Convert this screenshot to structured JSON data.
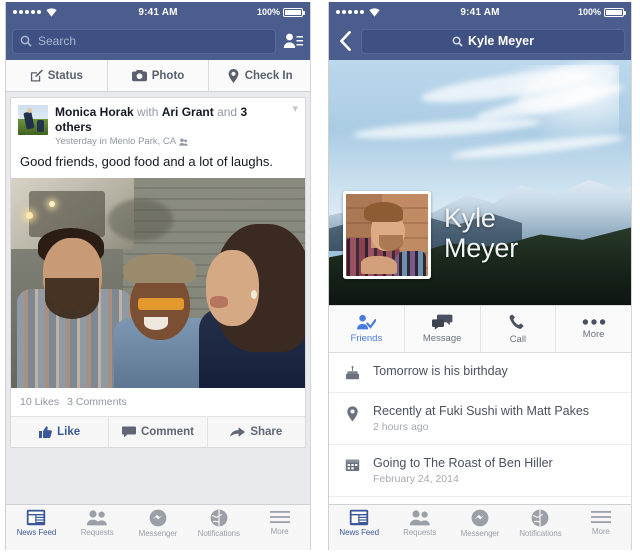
{
  "statusbar": {
    "signal_dots": 5,
    "wifi_icon": "wifi-icon",
    "time": "9:41 AM",
    "battery_percent": "100%",
    "battery_icon": "battery-full-icon",
    "bar_color": "#4b5d8c"
  },
  "left_phone": {
    "navbar": {
      "search_placeholder": "Search",
      "search_icon": "search-icon",
      "friends_icon": "friend-requests-icon"
    },
    "composer": {
      "buttons": [
        {
          "label": "Status",
          "icon": "pencil-square-icon"
        },
        {
          "label": "Photo",
          "icon": "camera-icon"
        },
        {
          "label": "Check In",
          "icon": "location-pin-icon"
        }
      ]
    },
    "post": {
      "author": "Monica Horak",
      "with_word": "with",
      "tagged_primary": "Ari Grant",
      "and_word": "and",
      "tagged_others": "3 others",
      "timestamp": "Yesterday in Menlo Park, CA",
      "privacy_icon": "friends-privacy-icon",
      "more_icon": "chevron-down-icon",
      "avatar_icon": "post-author-avatar",
      "message": "Good friends, good food and a lot of laughs.",
      "photo_alt": "three-friends-laughing-photo",
      "likes": "10 Likes",
      "comments": "3 Comments",
      "actions": [
        {
          "label": "Like",
          "icon": "thumbs-up-icon",
          "active": true
        },
        {
          "label": "Comment",
          "icon": "comment-bubble-icon",
          "active": false
        },
        {
          "label": "Share",
          "icon": "share-arrow-icon",
          "active": false
        }
      ]
    }
  },
  "right_phone": {
    "navbar": {
      "back_icon": "chevron-left-icon",
      "search_icon": "search-icon",
      "search_value": "Kyle Meyer"
    },
    "profile": {
      "cover_alt": "mountain-cover-photo",
      "picture_alt": "kyle-meyer-profile-photo",
      "name_line1": "Kyle",
      "name_line2": "Meyer",
      "actions": [
        {
          "label": "Friends",
          "icon": "friend-check-icon",
          "active": true
        },
        {
          "label": "Message",
          "icon": "message-bubbles-icon",
          "active": false
        },
        {
          "label": "Call",
          "icon": "phone-icon",
          "active": false
        },
        {
          "label": "More",
          "icon": "ellipsis-icon",
          "active": false
        }
      ],
      "info_rows": [
        {
          "icon": "birthday-cake-icon",
          "main": "Tomorrow is his birthday",
          "sub": ""
        },
        {
          "icon": "location-pin-icon",
          "main": "Recently at Fuki Sushi with Matt Pakes",
          "sub": "2 hours ago"
        },
        {
          "icon": "calendar-icon",
          "main": "Going to The Roast of Ben Hiller",
          "sub": "February 24, 2014"
        }
      ]
    }
  },
  "tabbar": {
    "tabs": [
      {
        "label": "News Feed",
        "icon": "news-feed-icon",
        "active": true
      },
      {
        "label": "Requests",
        "icon": "friend-requests-icon",
        "active": false
      },
      {
        "label": "Messenger",
        "icon": "messenger-icon",
        "active": false
      },
      {
        "label": "Notifications",
        "icon": "globe-icon",
        "active": false
      },
      {
        "label": "More",
        "icon": "hamburger-icon",
        "active": false
      }
    ]
  },
  "colors": {
    "facebook_blue": "#3b5998",
    "navbar_blue": "#4b5d8c",
    "accent_blue": "#4a7ddb",
    "feed_bg": "#e9eaed"
  }
}
